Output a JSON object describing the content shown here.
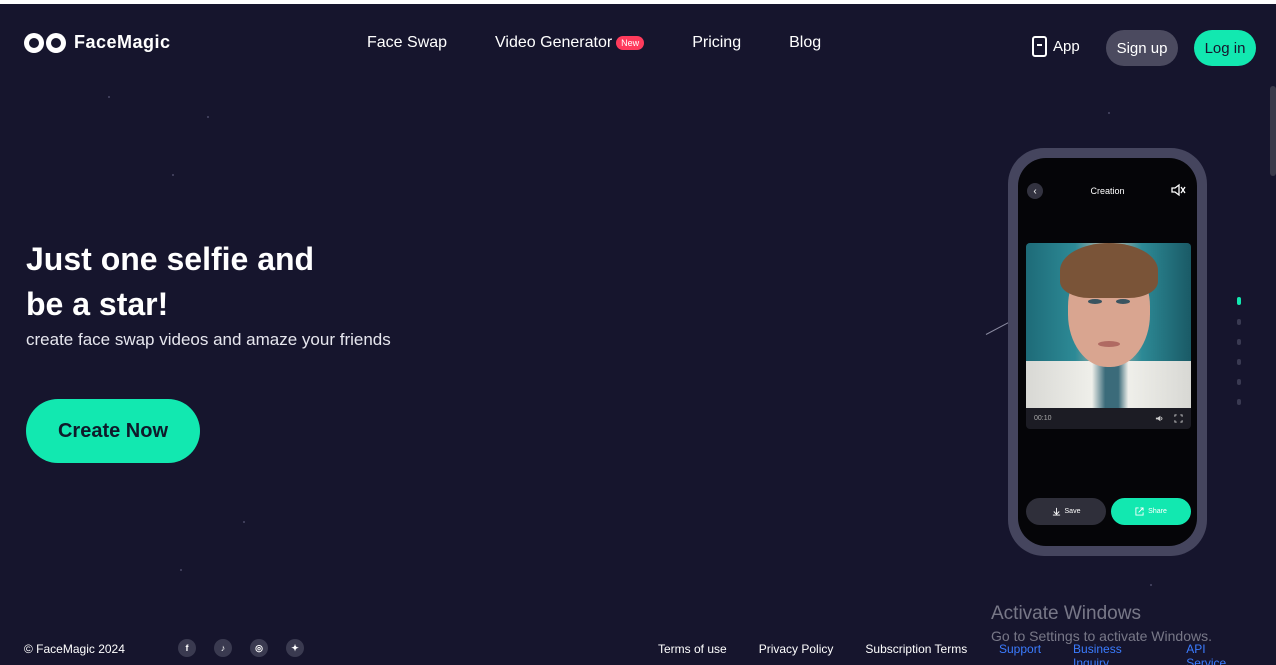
{
  "header": {
    "brand": "FaceMagic",
    "nav": [
      {
        "label": "Face Swap"
      },
      {
        "label": "Video Generator",
        "badge": "New"
      },
      {
        "label": "Pricing"
      },
      {
        "label": "Blog"
      }
    ],
    "app_label": "App",
    "signup_label": "Sign up",
    "login_label": "Log in"
  },
  "hero": {
    "title_line1": "Just one selfie and",
    "title_line2": "be a star!",
    "subtitle": "create face swap videos and amaze your friends",
    "cta_label": "Create Now"
  },
  "phone": {
    "screen_title": "Creation",
    "video_time": "00:10",
    "save_label": "Save",
    "share_label": "Share"
  },
  "pager": {
    "count": 6,
    "active_index": 0
  },
  "footer": {
    "copyright": "© FaceMagic 2024",
    "socials": [
      "facebook-icon",
      "tiktok-icon",
      "instagram-icon",
      "twitter-icon"
    ],
    "links": [
      "Terms of use",
      "Privacy Policy",
      "Subscription Terms"
    ],
    "links_blue": [
      "Support",
      "Business Inquiry",
      "API Service"
    ]
  },
  "watermark": {
    "title": "Activate Windows",
    "subtitle": "Go to Settings to activate Windows."
  },
  "colors": {
    "background": "#16152d",
    "accent": "#12e8b0",
    "badge": "#ff3b5c",
    "link_blue": "#3b7cff"
  }
}
